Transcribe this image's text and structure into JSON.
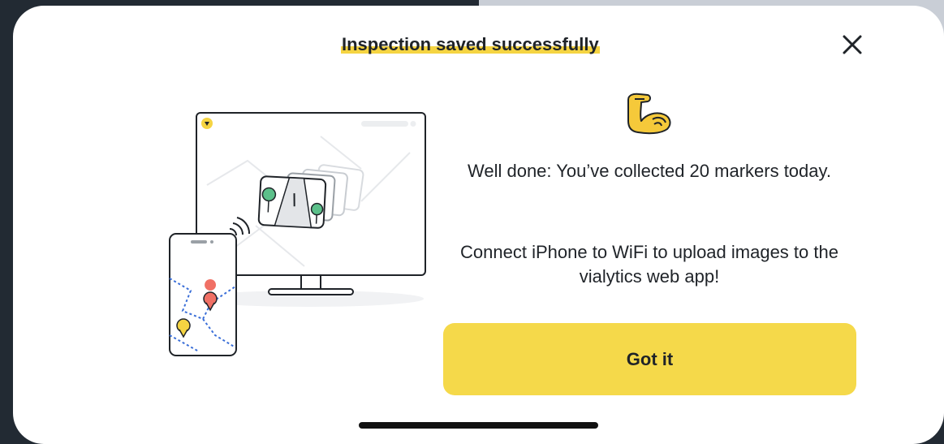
{
  "dialog": {
    "title": "Inspection saved successfully",
    "message_primary": "Well done: You’ve collected 20 markers today.",
    "message_secondary": "Connect iPhone to WiFi to upload images to the vialytics web app!",
    "confirm_label": "Got it",
    "icons": {
      "close": "close-icon",
      "emoji": "flexed-biceps-icon",
      "illustration": "sync-illustration"
    }
  },
  "colors": {
    "accent": "#f5d94a",
    "text": "#1f2328",
    "backdrop": "#222a33",
    "pin_red": "#f07065",
    "pin_yellow": "#f5d442",
    "tree_green": "#5cc08a"
  }
}
